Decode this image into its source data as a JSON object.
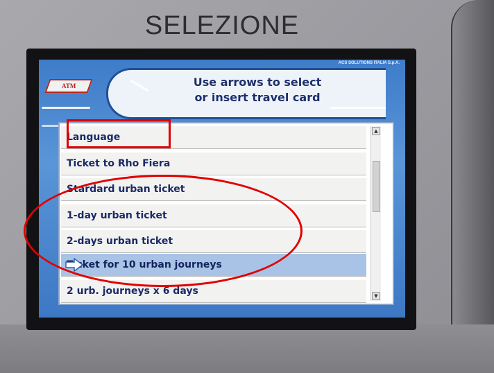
{
  "kiosk": {
    "title": "SELEZIONE"
  },
  "screen": {
    "vendor": "ACS SOLUTIONS ITALIA S.p.A.",
    "logo": "ATM",
    "instruction_line1": "Use arrows to select",
    "instruction_line2": "or insert travel card"
  },
  "menu": {
    "items": [
      {
        "label": "Language"
      },
      {
        "label": "Ticket to Rho Fiera"
      },
      {
        "label": "Stardard urban ticket"
      },
      {
        "label": "1-day urban ticket"
      },
      {
        "label": "2-days urban ticket"
      },
      {
        "label": "Ticket for 10 urban journeys"
      },
      {
        "label": "2 urb. journeys x 6 days"
      }
    ],
    "selected_index": 5
  },
  "colors": {
    "screen_blue": "#4a86d0",
    "selected_row": "#a9c3e6",
    "text_navy": "#1b2a66",
    "annotation_red": "#e00000"
  }
}
